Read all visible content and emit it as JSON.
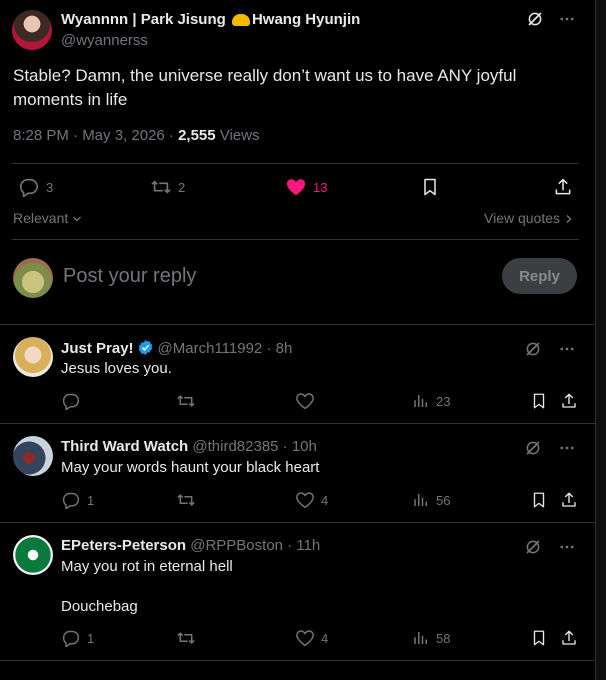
{
  "main_tweet": {
    "author_name_part1": "Wyannnn | Park Jisung",
    "author_name_part2": "Hwang Hyunjin",
    "handle": "@wyannerss",
    "text_line1": "Stable? Damn, the universe really don’t want us to have ANY joyful",
    "text_line2": "moments  in life",
    "time": "8:28 PM · May 3, 2026 ·",
    "views_count": "2,555",
    "views_label": "Views",
    "replies": "3",
    "reposts": "2",
    "likes": "13"
  },
  "filters": {
    "sort_label": "Relevant",
    "view_quotes_label": "View quotes"
  },
  "reply_box": {
    "placeholder": "Post your reply",
    "button_label": "Reply"
  },
  "replies": [
    {
      "name": "Just Pray!",
      "handle": "@March111992 · 8h",
      "verified": true,
      "text": "Jesus loves you.",
      "replies": "",
      "likes": "",
      "views": "23"
    },
    {
      "name": "Third Ward Watch",
      "handle": "@third82385 · 10h",
      "verified": false,
      "text": "May your words haunt your black heart",
      "replies": "1",
      "likes": "4",
      "views": "56"
    },
    {
      "name": "EPeters-Peterson",
      "handle": "@RPPBoston · 11h",
      "verified": false,
      "text_line1": "May you rot in eternal hell",
      "text_line2": "Douchebag",
      "replies": "1",
      "likes": "4",
      "views": "58"
    }
  ],
  "colors": {
    "background": "#000000",
    "text_primary": "#e7e9ea",
    "text_secondary": "#71767b",
    "like_pink": "#f91880",
    "verified_blue": "#1d9bf0",
    "divider": "#2f3336"
  }
}
